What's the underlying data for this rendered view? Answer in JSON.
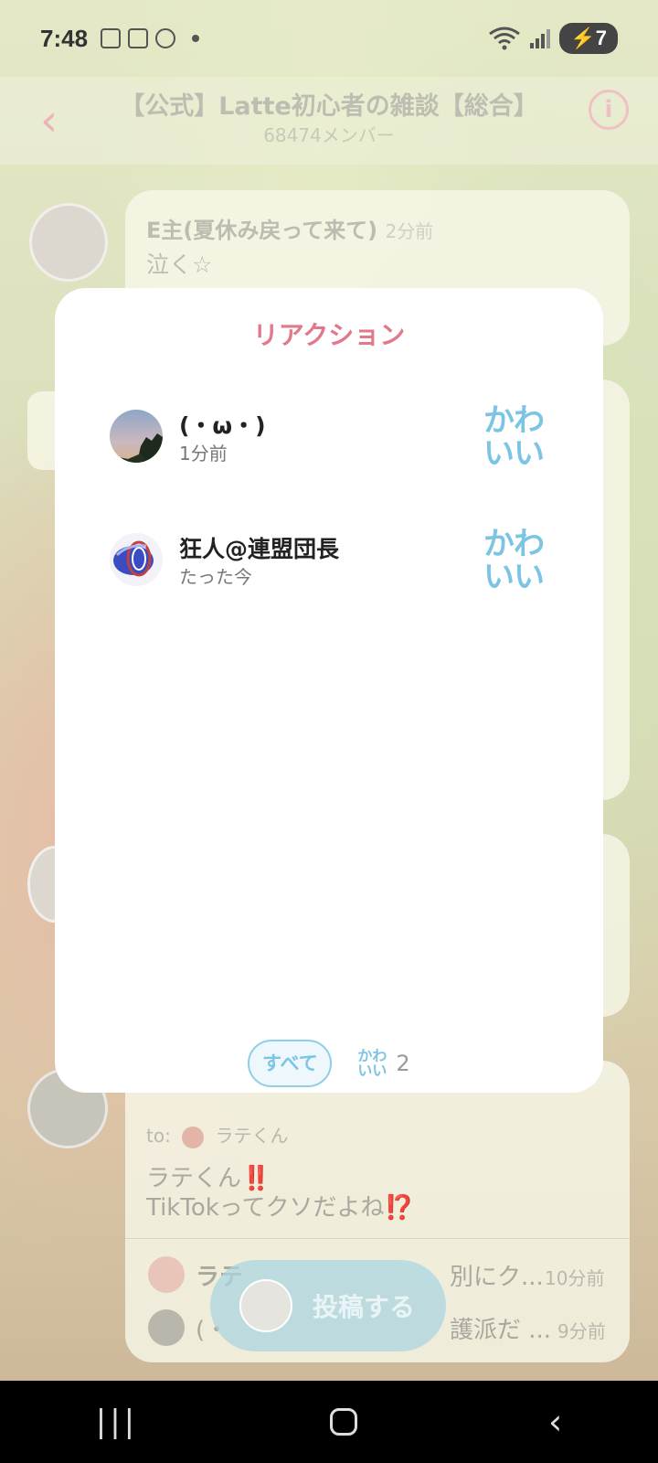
{
  "status_bar": {
    "time": "7:48",
    "battery": "7"
  },
  "header": {
    "title": "【公式】Latte初心者の雑談【総合】",
    "members": "68474メンバー"
  },
  "background_chat": {
    "msg1": {
      "name": "E主(夏休み戻って来て)",
      "time": "2分前",
      "text": "泣く☆"
    },
    "msg2": {
      "to_label": "to:",
      "to_name": "ラテくん",
      "line1": "ラテくん‼️",
      "line2": "TikTokってクソだよね⁉️"
    },
    "thread1": {
      "text": "ラテ",
      "text_tail": "別にク...",
      "time": "10分前"
    },
    "thread2": {
      "text": "(・",
      "text_tail": "護派だ ...",
      "time": "9分前"
    }
  },
  "post_button": {
    "label": "投稿する"
  },
  "modal": {
    "title": "リアクション",
    "reactions": [
      {
        "name": "(・ω・)",
        "time": "1分前",
        "badge_line1": "かわ",
        "badge_line2": "いい"
      },
      {
        "name": "狂人@連盟団長",
        "time": "たった今",
        "badge_line1": "かわ",
        "badge_line2": "いい"
      }
    ],
    "tabs": {
      "all_label": "すべて",
      "kawaii_line1": "かわ",
      "kawaii_line2": "いい",
      "kawaii_count": "2"
    }
  },
  "nav": {
    "recent": "|||",
    "back": "‹"
  }
}
